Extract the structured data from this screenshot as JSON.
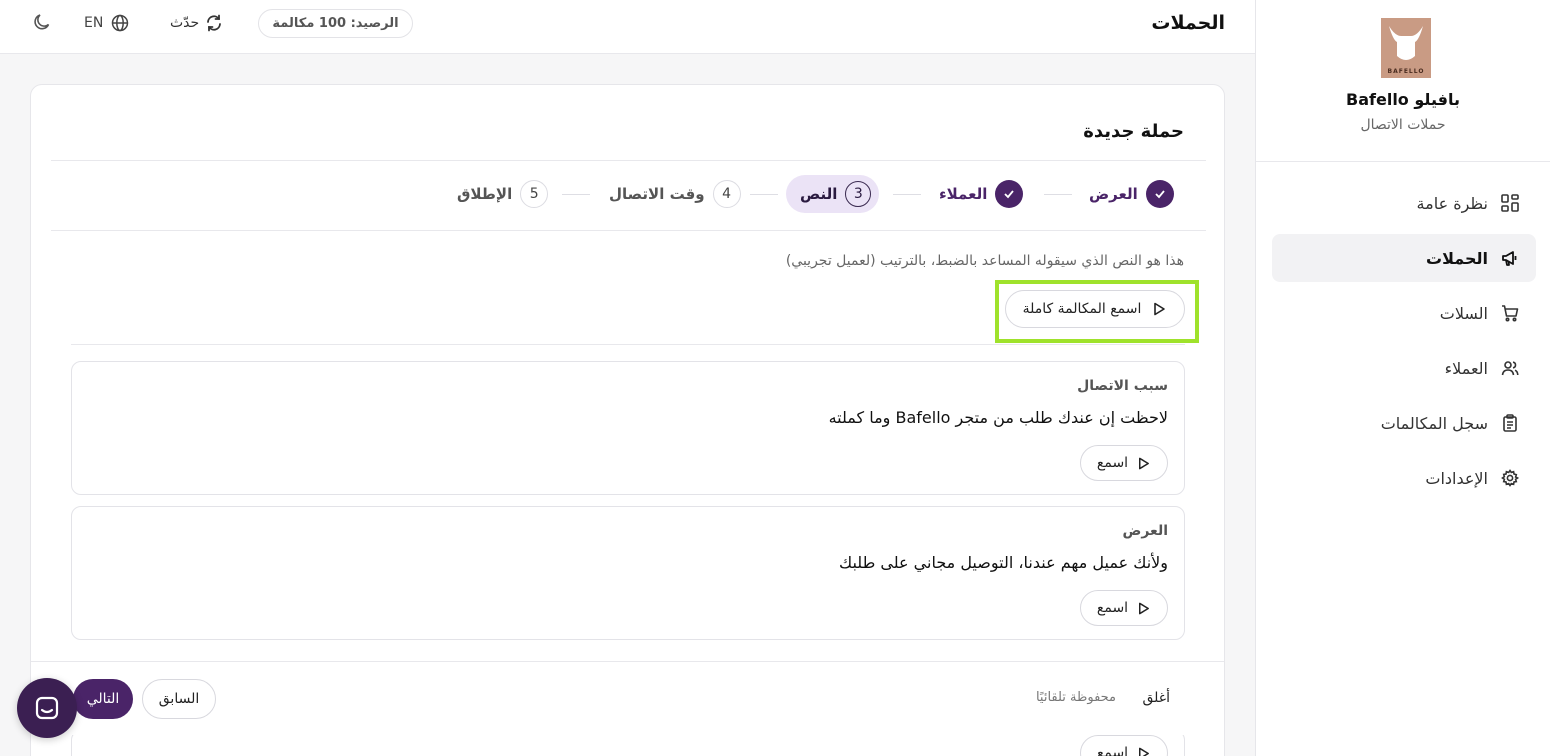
{
  "header": {
    "page_title": "الحملات",
    "balance": "الرصيد: 100 مكالمة",
    "refresh_label": "حدّث",
    "language_label": "EN"
  },
  "sidebar": {
    "brand_name": "Bafello بافيلو",
    "brand_subtitle": "حملات الاتصال",
    "logo_text": "BAFELLO",
    "items": [
      {
        "label": "نظرة عامة",
        "icon": "grid-icon",
        "active": false
      },
      {
        "label": "الحملات",
        "icon": "megaphone-icon",
        "active": true
      },
      {
        "label": "السلات",
        "icon": "cart-icon",
        "active": false
      },
      {
        "label": "العملاء",
        "icon": "users-icon",
        "active": false
      },
      {
        "label": "سجل المكالمات",
        "icon": "clipboard-icon",
        "active": false
      },
      {
        "label": "الإعدادات",
        "icon": "gear-icon",
        "active": false
      }
    ]
  },
  "campaign": {
    "title": "حملة جديدة",
    "steps": [
      {
        "number": "1",
        "label": "العرض",
        "state": "done"
      },
      {
        "number": "2",
        "label": "العملاء",
        "state": "done"
      },
      {
        "number": "3",
        "label": "النص",
        "state": "current"
      },
      {
        "number": "4",
        "label": "وقت الاتصال",
        "state": "todo"
      },
      {
        "number": "5",
        "label": "الإطلاق",
        "state": "todo"
      }
    ],
    "description": "هذا هو النص الذي سيقوله المساعد بالضبط، بالترتيب (لعميل تجريبي)",
    "play_full_label": "اسمع المكالمة كاملة",
    "segments": [
      {
        "title": "سبب الاتصال",
        "text": "لاحظت إن عندك طلب من متجر Bafello وما كملته",
        "listen_label": "اسمع"
      },
      {
        "title": "العرض",
        "text": "ولأنك عميل مهم عندنا، التوصيل مجاني على طلبك",
        "listen_label": "اسمع"
      }
    ],
    "peek_listen_label": "اسمع"
  },
  "footer": {
    "close_label": "أغلق",
    "autosave_label": "محفوظة تلقائيًا",
    "prev_label": "السابق",
    "next_label": "التالي"
  },
  "colors": {
    "accent": "#4a2468",
    "highlight": "#9fe22b",
    "step_current_bg": "#ebe3f6"
  }
}
